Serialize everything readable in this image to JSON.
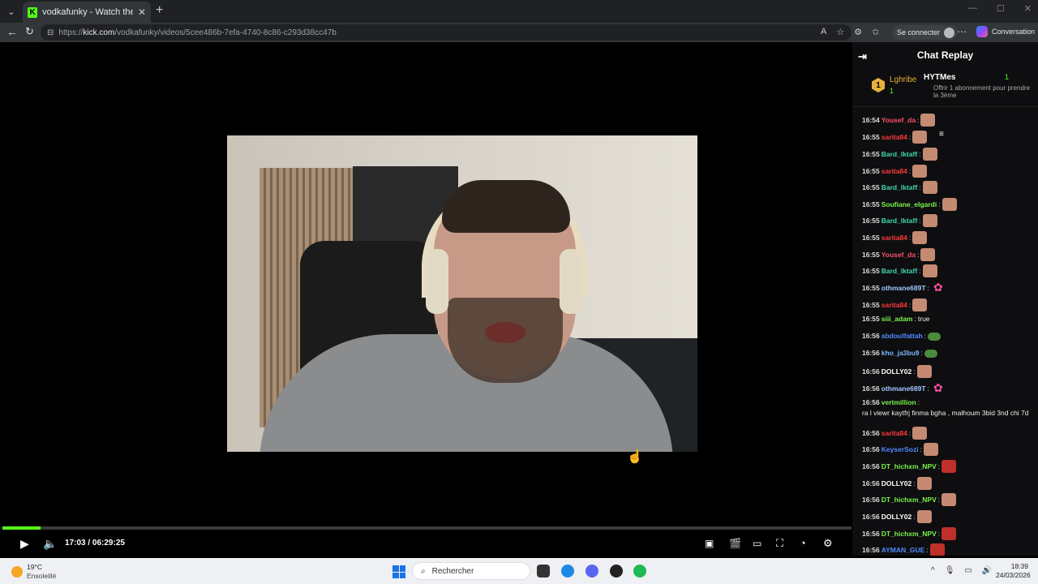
{
  "browser": {
    "tab_title": "vodkafunky - Watch the VOD on K",
    "url_prefix": "https://",
    "url_domain": "kick.com",
    "url_path": "/vodkafunky/videos/5cee486b-7efa-4740-8c86-c293d38cc47b",
    "signin_label": "Se connecter",
    "copilot_label": "Conversation"
  },
  "player": {
    "current_time": "17:03",
    "separator": "/",
    "duration": "06:29:25",
    "progress_fraction": 0.045
  },
  "chat": {
    "title": "Chat Replay",
    "pinned": {
      "rank": "1",
      "gifter": "Lghribe",
      "gifter_count": "1",
      "sub_user": "HYTMes",
      "sub_count": "1",
      "sub_desc": "Offrir 1 abonnement pour prendre la 3ème"
    },
    "messages": [
      {
        "time": "16:54",
        "user": "Yousef_da",
        "color": "#ff4f6a",
        "text": "",
        "emote": "e-face"
      },
      {
        "time": "16:55",
        "user": "sarita84",
        "color": "#ff3b3b",
        "text": "",
        "emote": "e-face"
      },
      {
        "time": "16:55",
        "user": "Bard_lktaff",
        "color": "#3fd9b0",
        "text": "",
        "emote": "e-face"
      },
      {
        "time": "16:55",
        "user": "sarita84",
        "color": "#ff3b3b",
        "text": "",
        "emote": "e-face"
      },
      {
        "time": "16:55",
        "user": "Bard_lktaff",
        "color": "#3fd9b0",
        "text": "",
        "emote": "e-face"
      },
      {
        "time": "16:55",
        "user": "Soufiane_elgardi",
        "color": "#7bf34a",
        "text": "",
        "emote": "e-face"
      },
      {
        "time": "16:55",
        "user": "Bard_lktaff",
        "color": "#3fd9b0",
        "text": "",
        "emote": "e-face"
      },
      {
        "time": "16:55",
        "user": "sarita84",
        "color": "#ff3b3b",
        "text": "",
        "emote": "e-face"
      },
      {
        "time": "16:55",
        "user": "Yousef_da",
        "color": "#ff4f6a",
        "text": "",
        "emote": "e-face"
      },
      {
        "time": "16:55",
        "user": "Bard_lktaff",
        "color": "#3fd9b0",
        "text": "",
        "emote": "e-face"
      },
      {
        "time": "16:55",
        "user": "othmane689T",
        "color": "#9fc8ff",
        "text": "",
        "emote": "e-pink"
      },
      {
        "time": "16:55",
        "user": "sarita84",
        "color": "#ff3b3b",
        "text": "",
        "emote": "e-face"
      },
      {
        "time": "16:55",
        "user": "siii_adam",
        "color": "#7bf34a",
        "text": "true",
        "emote": ""
      },
      {
        "time": "16:56",
        "user": "abdoulfattah",
        "color": "#4f8bff",
        "text": "",
        "emote": "e-frog"
      },
      {
        "time": "16:56",
        "user": "kho_ja3bu9",
        "color": "#7fb8ff",
        "text": "",
        "emote": "e-frog"
      },
      {
        "time": "16:56",
        "user": "DOLLY02",
        "color": "#ffffff",
        "text": "",
        "emote": "e-face"
      },
      {
        "time": "16:56",
        "user": "othmane689T",
        "color": "#9fc8ff",
        "text": "",
        "emote": "e-pink"
      },
      {
        "time": "16:56",
        "user": "vertmillion",
        "color": "#7bf34a",
        "text": "ra l viewr kaytfrj finma bgha , malhoum 3bid 3nd chi 7d",
        "emote": ""
      },
      {
        "time": "16:56",
        "user": "sarita84",
        "color": "#ff3b3b",
        "text": "",
        "emote": "e-face"
      },
      {
        "time": "16:56",
        "user": "KeyserSozi",
        "color": "#4f8bff",
        "text": "",
        "emote": "e-face"
      },
      {
        "time": "16:56",
        "user": "DT_hichxm_NPV",
        "color": "#7bf34a",
        "text": "",
        "emote": "e-red"
      },
      {
        "time": "16:56",
        "user": "DOLLY02",
        "color": "#ffffff",
        "text": "",
        "emote": "e-face"
      },
      {
        "time": "16:56",
        "user": "DT_hichxm_NPV",
        "color": "#7bf34a",
        "text": "",
        "emote": "e-face"
      },
      {
        "time": "16:56",
        "user": "DOLLY02",
        "color": "#ffffff",
        "text": "",
        "emote": "e-face"
      },
      {
        "time": "16:56",
        "user": "DT_hichxm_NPV",
        "color": "#7bf34a",
        "text": "",
        "emote": "e-red"
      },
      {
        "time": "16:56",
        "user": "AYMAN_GUE",
        "color": "#4f8bff",
        "text": "",
        "emote": "e-red"
      }
    ]
  },
  "taskbar": {
    "temperature": "19°C",
    "weather": "Ensoleillé",
    "search_label": "Rechercher",
    "time": "18:39",
    "date": "24/03/2026"
  },
  "colors": {
    "kick_green": "#53fc18"
  }
}
